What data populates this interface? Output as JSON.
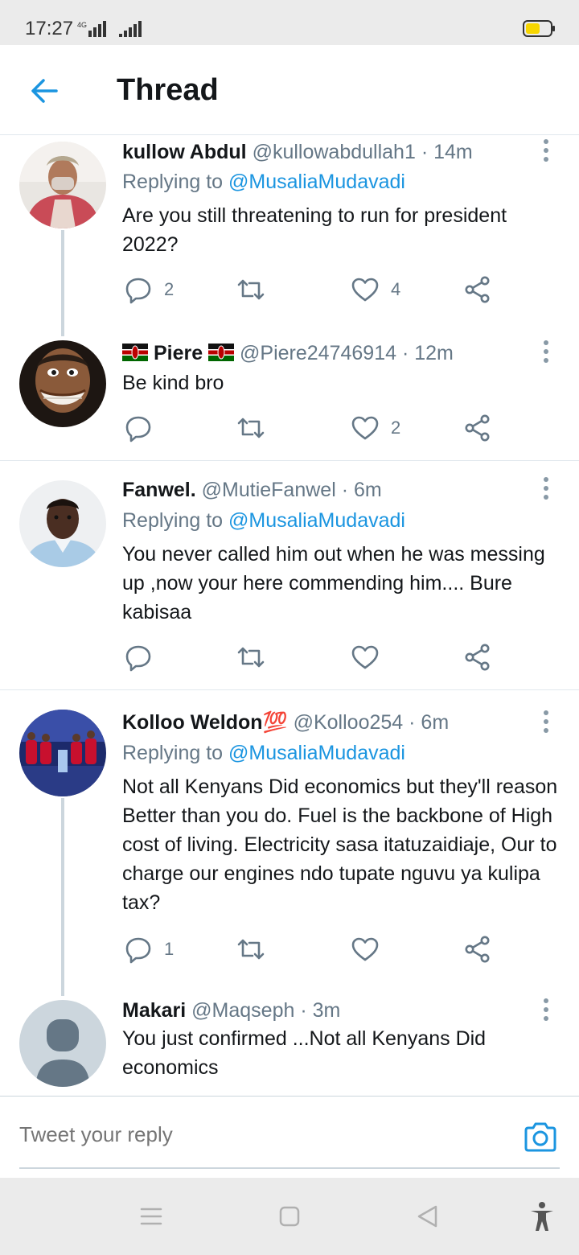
{
  "status_bar": {
    "time": "17:27",
    "network": "4G",
    "battery_color": "#f7d600"
  },
  "header": {
    "title": "Thread",
    "back_icon": "arrow-left-icon"
  },
  "colors": {
    "accent": "#1b95e0",
    "text": "#14171a",
    "muted": "#657786"
  },
  "tweets": [
    {
      "name": "kullow Abdul",
      "handle": "@kullowabdullah1",
      "time": "· 14m",
      "replying_label": "Replying to",
      "replying_to": "@MusaliaMudavadi",
      "text": "Are you still threatening to run for president 2022?",
      "replies": "2",
      "retweets": "",
      "likes": "4"
    },
    {
      "name": "Piere",
      "handle": "@Piere24746914",
      "time": "· 12m",
      "text": "Be kind bro",
      "replies": "",
      "retweets": "",
      "likes": "2"
    },
    {
      "name": "Fanwel.",
      "handle": "@MutieFanwel",
      "time": "· 6m",
      "replying_label": "Replying to",
      "replying_to": "@MusaliaMudavadi",
      "text": "You never called him out when he was messing up ,now your here commending him.... Bure kabisaa",
      "replies": "",
      "retweets": "",
      "likes": ""
    },
    {
      "name": "Kolloo Weldon💯",
      "handle": "@Kolloo254",
      "time": "· 6m",
      "replying_label": "Replying to",
      "replying_to": "@MusaliaMudavadi",
      "text": "Not all Kenyans Did economics but they'll reason Better than you do. Fuel is the backbone of High cost of living. Electricity sasa itatuzaidiaje, Our to charge our engines ndo tupate nguvu ya kulipa tax?",
      "replies": "1",
      "retweets": "",
      "likes": ""
    },
    {
      "name": "Makari",
      "handle": "@Maqseph",
      "time": "· 3m",
      "text": "You just confirmed ...Not all Kenyans Did economics"
    }
  ],
  "composer": {
    "placeholder": "Tweet your reply",
    "camera_icon": "camera-icon"
  },
  "nav": {
    "icons": [
      "menu-icon",
      "home-square-icon",
      "back-triangle-icon",
      "accessibility-icon"
    ]
  }
}
